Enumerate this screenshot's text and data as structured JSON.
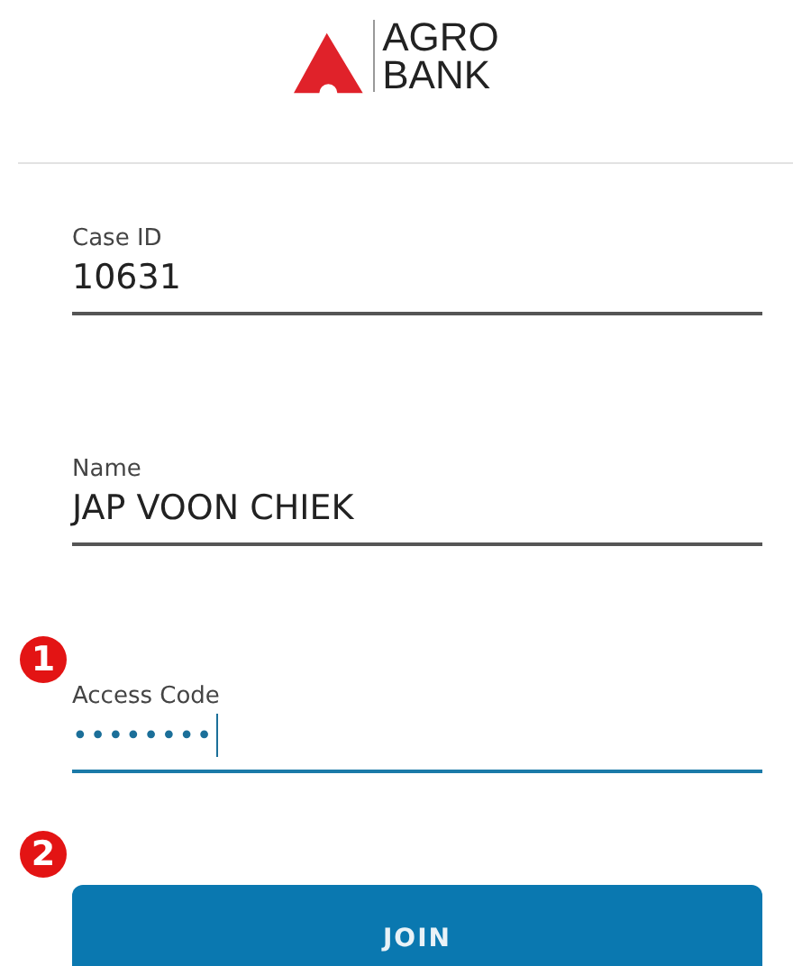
{
  "logo": {
    "line_1": "AGRO",
    "line_2": "BANK"
  },
  "fields": [
    {
      "label": "Case ID",
      "value": "10631",
      "focused": false
    },
    {
      "label": "Name",
      "value": "JAP VOON CHIEK",
      "focused": false
    },
    {
      "label": "Access Code",
      "value": "••••••••",
      "focused": true,
      "step": "1"
    }
  ],
  "join_button": {
    "label": "JOIN",
    "step": "2"
  }
}
